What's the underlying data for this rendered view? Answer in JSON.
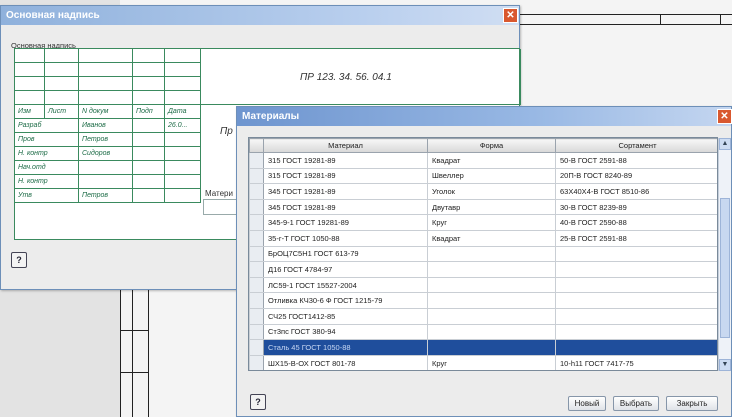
{
  "title_block_window": {
    "title": "Основная надпись",
    "group_label": "Основная надпись",
    "designation": "ПР 123. 34. 56. 04.1",
    "name_partial": "Пр",
    "material_label_partial": "Матери",
    "header_cells": [
      "Изм",
      "Лист",
      "N докум",
      "Подп",
      "Дата"
    ],
    "rows": [
      {
        "role": "Разраб",
        "name": "Иванов",
        "date": "26.0..."
      },
      {
        "role": "Пров",
        "name": "Петров",
        "date": ""
      },
      {
        "role": "Н. контр",
        "name": "Сидоров",
        "date": ""
      },
      {
        "role": "Нач.отд",
        "name": "",
        "date": ""
      },
      {
        "role": "Н. контр",
        "name": "",
        "date": ""
      },
      {
        "role": "Утв",
        "name": "Петров",
        "date": ""
      }
    ]
  },
  "materials_window": {
    "title": "Материалы",
    "columns": [
      "Материал",
      "Форма",
      "Сортамент"
    ],
    "rows": [
      {
        "material": "315 ГОСТ 19281-89",
        "form": "Квадрат",
        "sortament": "50-В ГОСТ 2591-88"
      },
      {
        "material": "315 ГОСТ 19281-89",
        "form": "Швеллер",
        "sortament": "20П-В ГОСТ 8240-89"
      },
      {
        "material": "345 ГОСТ 19281-89",
        "form": "Уголок",
        "sortament": "63Х40Х4-В ГОСТ 8510-86"
      },
      {
        "material": "345 ГОСТ 19281-89",
        "form": "Двутавр",
        "sortament": "30-В ГОСТ 8239-89"
      },
      {
        "material": "345-9-1 ГОСТ 19281-89",
        "form": "Круг",
        "sortament": "40-В ГОСТ 2590-88"
      },
      {
        "material": "35-г-Т ГОСТ 1050-88",
        "form": "Квадрат",
        "sortament": "25-В ГОСТ 2591-88"
      },
      {
        "material": "БрОЦ7С5Н1 ГОСТ 613-79",
        "form": "",
        "sortament": ""
      },
      {
        "material": "Д16 ГОСТ 4784-97",
        "form": "",
        "sortament": ""
      },
      {
        "material": "ЛС59-1 ГОСТ 15527-2004",
        "form": "",
        "sortament": ""
      },
      {
        "material": "Отливка КЧ30-6 Ф ГОСТ 1215-79",
        "form": "",
        "sortament": ""
      },
      {
        "material": "СЧ25 ГОСТ1412-85",
        "form": "",
        "sortament": ""
      },
      {
        "material": "Ст3пс ГОСТ 380-94",
        "form": "",
        "sortament": ""
      },
      {
        "material": "Сталь 45 ГОСТ 1050-88",
        "form": "",
        "sortament": "",
        "selected": true
      },
      {
        "material": "ШХ15-В-ОХ ГОСТ 801-78",
        "form": "Круг",
        "sortament": "10-h11 ГОСТ 7417-75"
      }
    ],
    "buttons": {
      "new": "Новый",
      "select": "Выбрать",
      "close": "Закрыть"
    }
  },
  "icons": {
    "close": "close-icon",
    "help": "help-icon",
    "scroll_up": "chevron-up-icon",
    "scroll_down": "chevron-down-icon"
  },
  "colors": {
    "title_bar": "#7fa3d4",
    "close_button": "#d9582f",
    "selection": "#1f4e9c",
    "stamp_lines": "#3a8a5e"
  }
}
